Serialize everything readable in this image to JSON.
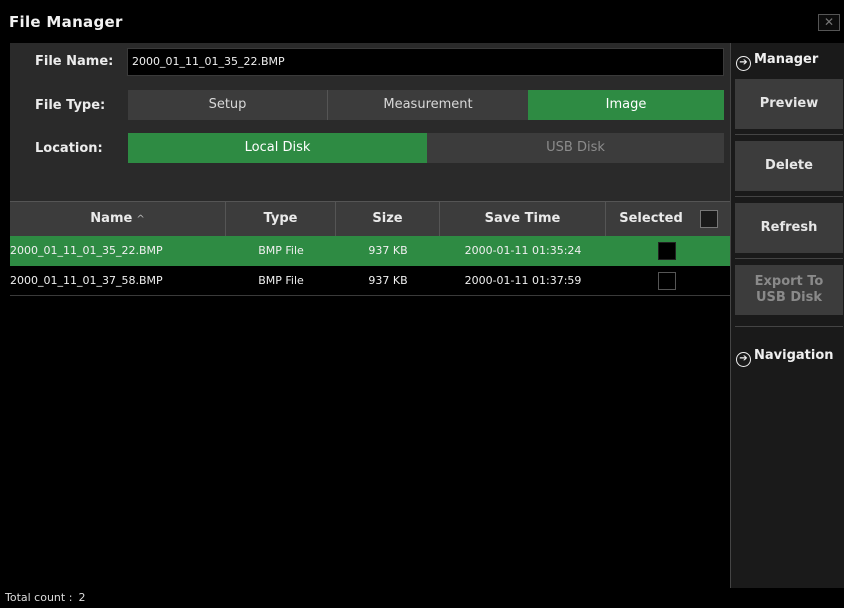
{
  "window": {
    "title": "File Manager",
    "close_label": "✕"
  },
  "form": {
    "file_name_label": "File Name:",
    "file_name_value": "2000_01_11_01_35_22.BMP",
    "file_type_label": "File Type:",
    "file_types": [
      "Setup",
      "Measurement",
      "Image"
    ],
    "file_type_selected": "Image",
    "location_label": "Location:",
    "locations": [
      "Local Disk",
      "USB Disk"
    ],
    "location_selected": "Local Disk"
  },
  "table": {
    "columns": [
      "Name",
      "Type",
      "Size",
      "Save Time",
      "Selected"
    ],
    "sort_column": "Name",
    "sort_icon": "^",
    "rows": [
      {
        "name": "2000_01_11_01_35_22.BMP",
        "type": "BMP File",
        "size": "937 KB",
        "save_time": "2000-01-11 01:35:24",
        "selected": true
      },
      {
        "name": "2000_01_11_01_37_58.BMP",
        "type": "BMP File",
        "size": "937 KB",
        "save_time": "2000-01-11 01:37:59",
        "selected": false
      }
    ]
  },
  "footer": {
    "total_label": "Total count :",
    "total_value": "2"
  },
  "sidebar": {
    "manager_label": "Manager",
    "navigation_label": "Navigation",
    "buttons": {
      "preview": "Preview",
      "delete": "Delete",
      "refresh": "Refresh",
      "export_line1": "Export To",
      "export_line2": "USB Disk"
    }
  },
  "colors": {
    "accent": "#2e8b43",
    "button": "#3c3c3c",
    "panel": "#2a2a2a",
    "background": "#000000"
  }
}
